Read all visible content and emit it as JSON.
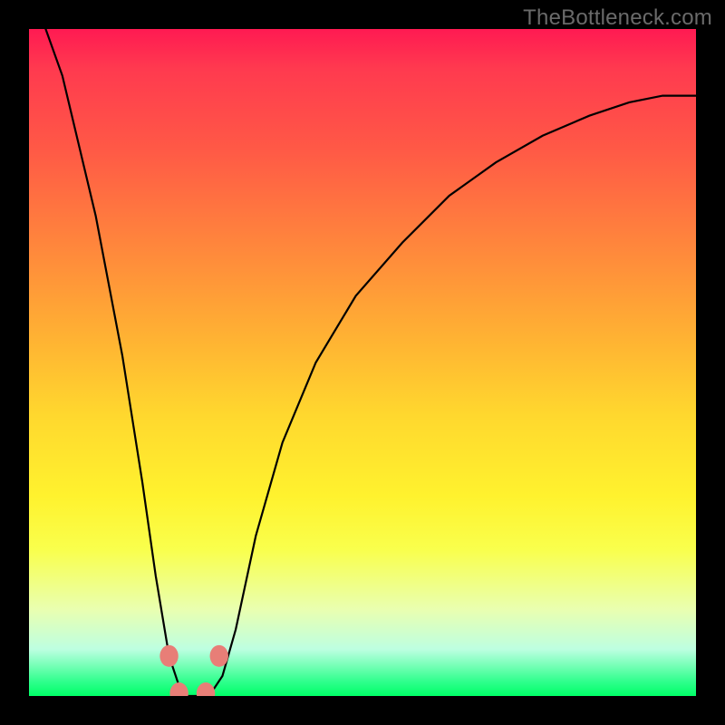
{
  "watermark": "TheBottleneck.com",
  "chart_data": {
    "type": "line",
    "title": "",
    "xlabel": "",
    "ylabel": "",
    "x": [
      0,
      0.05,
      0.1,
      0.14,
      0.17,
      0.19,
      0.21,
      0.23,
      0.25,
      0.27,
      0.29,
      0.31,
      0.34,
      0.38,
      0.43,
      0.49,
      0.56,
      0.63,
      0.7,
      0.77,
      0.84,
      0.9,
      0.95,
      1.0
    ],
    "values": [
      1.07,
      0.93,
      0.72,
      0.51,
      0.32,
      0.18,
      0.06,
      0.0,
      0.0,
      0.0,
      0.03,
      0.1,
      0.24,
      0.38,
      0.5,
      0.6,
      0.68,
      0.75,
      0.8,
      0.84,
      0.87,
      0.89,
      0.9,
      0.9
    ],
    "xlim": [
      0,
      1
    ],
    "ylim": [
      0,
      1
    ],
    "series_name": "bottleneck-curve",
    "markers": [
      {
        "x": 0.21,
        "y": 0.06,
        "label": "left-upper-marker"
      },
      {
        "x": 0.225,
        "y": 0.004,
        "label": "left-lower-marker"
      },
      {
        "x": 0.265,
        "y": 0.004,
        "label": "right-lower-marker"
      },
      {
        "x": 0.285,
        "y": 0.06,
        "label": "right-upper-marker"
      }
    ],
    "marker_radius_px": 12,
    "colors": {
      "curve": "#000000",
      "marker_fill": "#e87e77",
      "gradient_top": "#ff1a52",
      "gradient_mid": "#fff22e",
      "gradient_bottom": "#00ff67",
      "frame": "#000000",
      "watermark": "#6a6a6a"
    }
  }
}
